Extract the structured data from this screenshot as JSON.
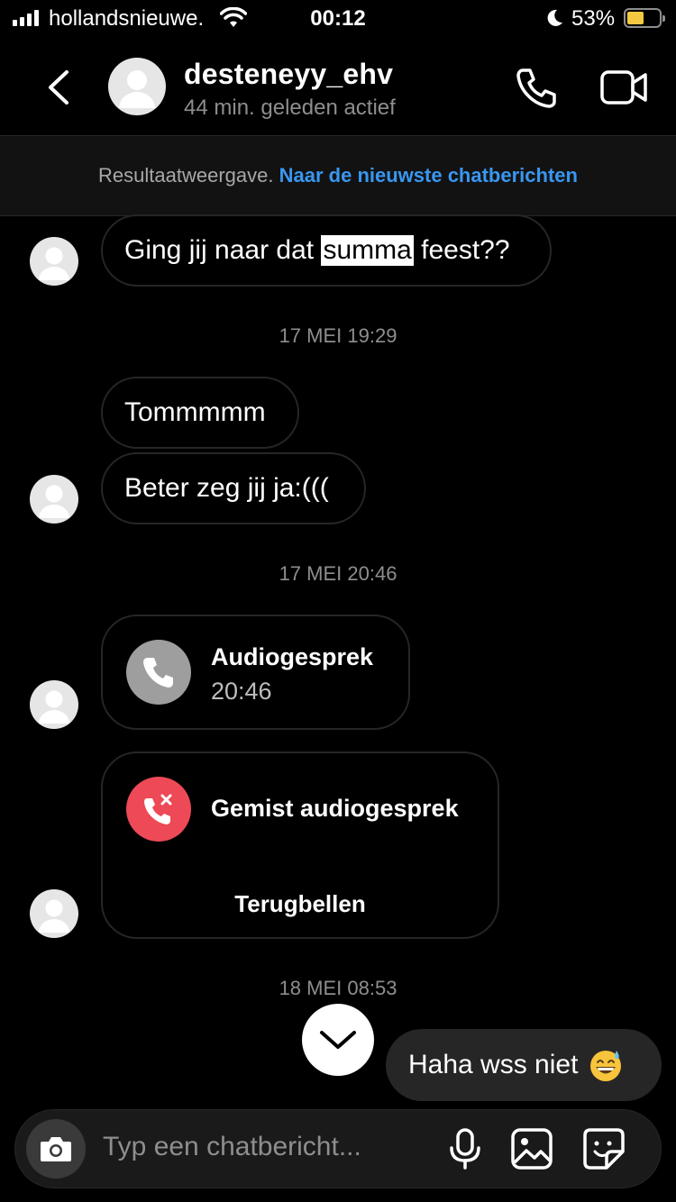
{
  "status_bar": {
    "carrier": "hollandsnieuwe.",
    "time": "00:12",
    "battery_percent": "53%",
    "battery_level": 0.53,
    "battery_color": "#f5c842"
  },
  "header": {
    "back_icon": "chevron-left-icon",
    "username": "desteneyy_ehv",
    "activity": "44 min. geleden actief",
    "call_icon": "phone-icon",
    "video_icon": "video-camera-icon"
  },
  "banner": {
    "text": "Resultaatweergave.",
    "link": "Naar de nieuwste chatberichten",
    "link_color": "#3897f0"
  },
  "messages": {
    "m1_before": "Ging jij naar dat ",
    "m1_highlight": "summa",
    "m1_after": " feest??",
    "ts1": "17 MEI 19:29",
    "m2": "Tommmmm",
    "m3": "Beter zeg jij ja:(((",
    "ts2": "17 MEI 20:46",
    "call1_title": "Audiogesprek",
    "call1_time": "20:46",
    "call2_title": "Gemist audiogesprek",
    "call2_action": "Terugbellen",
    "missed_color": "#ed4956",
    "ts3": "18 MEI 08:53",
    "sent": "Haha wss niet",
    "sent_emoji": "grinning-sweat-emoji"
  },
  "composer": {
    "placeholder": "Typ een chatbericht...",
    "icons": [
      "camera-icon",
      "microphone-icon",
      "image-icon",
      "sticker-icon"
    ]
  }
}
